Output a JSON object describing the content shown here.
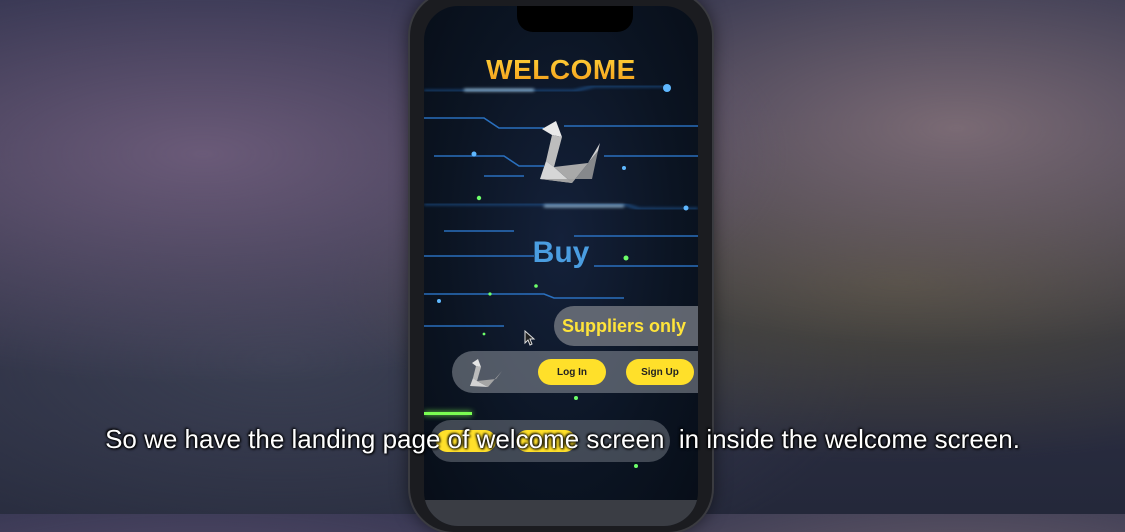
{
  "app": {
    "welcome_title": "WELCOME",
    "buy_label": "Buy",
    "suppliers_label": "Suppliers only",
    "login_label": "Log In",
    "signup_label": "Sign Up",
    "logo_icon": "origami-swan-icon"
  },
  "colors": {
    "welcome_top": "#ffd43a",
    "welcome_bottom": "#f39a1a",
    "buy_blue": "#4a9de0",
    "accent_yellow": "#ffe02a",
    "suppliers_text": "#ffe43a",
    "circuit_blue": "#3aa0ff",
    "circuit_green": "#6dff6a"
  },
  "video": {
    "subtitle": "So we have the landing page of welcome screen  in inside the welcome screen."
  }
}
